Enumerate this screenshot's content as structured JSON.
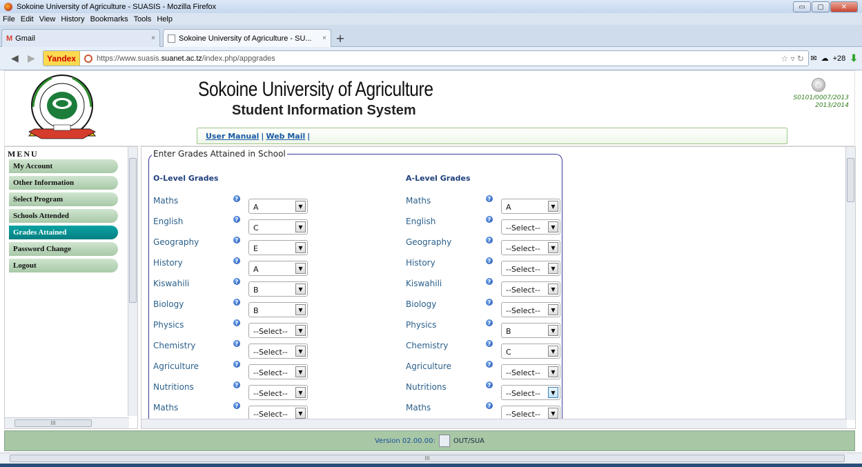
{
  "browser": {
    "window_title": "Sokoine University of Agriculture - SUASIS - Mozilla Firefox",
    "menu": [
      "File",
      "Edit",
      "View",
      "History",
      "Bookmarks",
      "Tools",
      "Help"
    ],
    "tabs": [
      {
        "label": "Gmail"
      },
      {
        "label": "Sokoine University of Agriculture - SU..."
      }
    ],
    "url_prefix": "https://www.suasis.",
    "url_host": "suanet.ac.tz",
    "url_path": "/index.php/appgrades",
    "search_engine": "Yandex",
    "weather": "+28",
    "window_buttons": {
      "minimize": "▭",
      "maximize": "▢",
      "close": "✕"
    }
  },
  "header": {
    "title": "Sokoine University of Agriculture",
    "subtitle": "Student Information System",
    "links": [
      "User Manual",
      "Web Mail"
    ],
    "user_id": "S0101/0007/2013",
    "year": "2013/2014",
    "logo_text": {
      "top": "UNIVERSITY OF AGRICULTURE",
      "left": "SOKOINE",
      "year": "1984",
      "motto": "ARDHI NI HAZINA"
    }
  },
  "sidebar": {
    "title": "MENU",
    "items": [
      "My Account",
      "Other Information",
      "Select Program",
      "Schools Attended",
      "Grades Attained",
      "Password Change",
      "Logout"
    ],
    "active_index": 4
  },
  "form": {
    "legend": "Enter Grades Attained in School",
    "o_level": {
      "heading": "O-Level Grades",
      "rows": [
        {
          "subject": "Maths",
          "grade": "A"
        },
        {
          "subject": "English",
          "grade": "C"
        },
        {
          "subject": "Geography",
          "grade": "E"
        },
        {
          "subject": "History",
          "grade": "A"
        },
        {
          "subject": "Kiswahili",
          "grade": "B"
        },
        {
          "subject": "Biology",
          "grade": "B"
        },
        {
          "subject": "Physics",
          "grade": "--Select--"
        },
        {
          "subject": "Chemistry",
          "grade": "--Select--"
        },
        {
          "subject": "Agriculture",
          "grade": "--Select--"
        },
        {
          "subject": "Nutritions",
          "grade": "--Select--"
        },
        {
          "subject": "Maths",
          "grade": "--Select--"
        }
      ]
    },
    "a_level": {
      "heading": "A-Level Grades",
      "rows": [
        {
          "subject": "Maths",
          "grade": "A"
        },
        {
          "subject": "English",
          "grade": "--Select--"
        },
        {
          "subject": "Geography",
          "grade": "--Select--"
        },
        {
          "subject": "History",
          "grade": "--Select--"
        },
        {
          "subject": "Kiswahili",
          "grade": "--Select--"
        },
        {
          "subject": "Biology",
          "grade": "--Select--"
        },
        {
          "subject": "Physics",
          "grade": "B"
        },
        {
          "subject": "Chemistry",
          "grade": "C"
        },
        {
          "subject": "Agriculture",
          "grade": "--Select--"
        },
        {
          "subject": "Nutritions",
          "grade": "--Select--"
        },
        {
          "subject": "Maths",
          "grade": "--Select--"
        }
      ]
    }
  },
  "footer": {
    "version": "Version 02.00.00:",
    "org": "OUT/SUA"
  },
  "scroll_grip": "III"
}
